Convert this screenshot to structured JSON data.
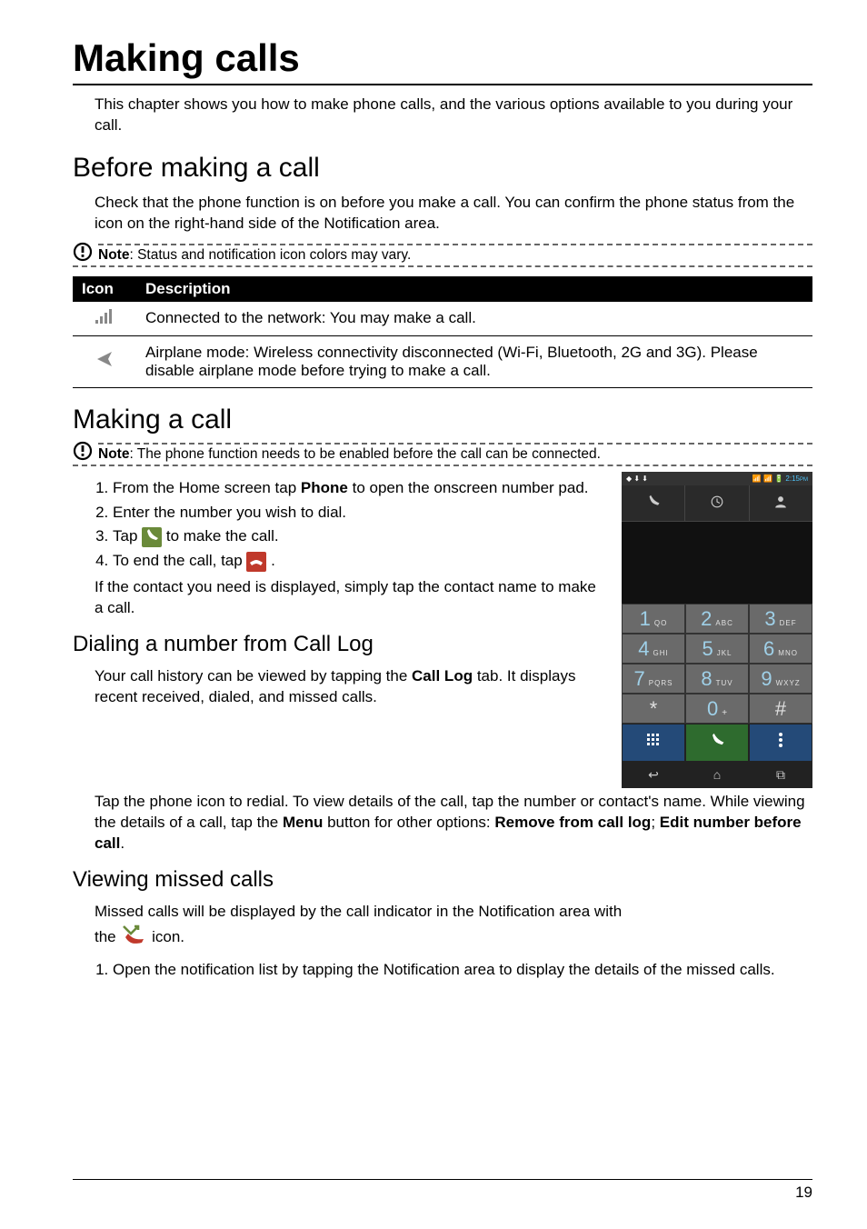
{
  "title": "Making calls",
  "intro": "This chapter shows you how to make phone calls, and the various options available to you during your call.",
  "section_before": {
    "heading": "Before making a call",
    "text": "Check that the phone function is on before you make a call. You can confirm the phone status from the icon on the right-hand side of the Notification area.",
    "note_label": "Note",
    "note_text": ": Status and notification icon colors may vary."
  },
  "table": {
    "headers": [
      "Icon",
      "Description"
    ],
    "rows": [
      {
        "icon": "signal-icon",
        "desc": "Connected to the network: You may make a call."
      },
      {
        "icon": "airplane-icon",
        "desc": "Airplane mode: Wireless connectivity disconnected (Wi-Fi, Bluetooth, 2G and 3G). Please disable airplane mode before trying to make a call."
      }
    ]
  },
  "section_making": {
    "heading": "Making a call",
    "note_label": "Note",
    "note_text": ": The phone function needs to be enabled before the call can be connected.",
    "step1_a": "From the Home screen tap ",
    "step1_b": "Phone",
    "step1_c": " to open the onscreen number pad.",
    "step2": "Enter the number you wish to dial.",
    "step3_a": "Tap ",
    "step3_b": " to make the call.",
    "step4_a": "To end the call, tap ",
    "step4_b": ".",
    "contact_text": "If the contact you need is displayed, simply tap the contact name to make a call."
  },
  "section_calllog": {
    "heading": "Dialing a number from Call Log",
    "p1_a": "Your call history can be viewed by tapping the ",
    "p1_b": "Call Log",
    "p1_c": " tab. It displays recent received, dialed, and missed calls.",
    "p2_a": "Tap the phone icon to redial. To view details of the call, tap the number or contact's name. While viewing the details of a call, tap the ",
    "p2_b": "Menu",
    "p2_c": " button for other options: ",
    "p2_d": "Remove from call log",
    "p2_e": "; ",
    "p2_f": "Edit number before call",
    "p2_g": "."
  },
  "section_missed": {
    "heading": "Viewing missed calls",
    "p1": "Missed calls will be displayed by the call indicator in the Notification area with",
    "p2_a": "the ",
    "p2_b": " icon.",
    "step1": "Open the notification list by tapping the Notification area to display the details of the missed calls."
  },
  "phone_mock": {
    "status_time": "2:15",
    "status_pm": "PM",
    "keys": [
      {
        "d": "1",
        "l": "QO"
      },
      {
        "d": "2",
        "l": "ABC"
      },
      {
        "d": "3",
        "l": "DEF"
      },
      {
        "d": "4",
        "l": "GHI"
      },
      {
        "d": "5",
        "l": "JKL"
      },
      {
        "d": "6",
        "l": "MNO"
      },
      {
        "d": "7",
        "l": "PQRS"
      },
      {
        "d": "8",
        "l": "TUV"
      },
      {
        "d": "9",
        "l": "WXYZ"
      },
      {
        "d": "*",
        "l": ""
      },
      {
        "d": "0",
        "l": "+"
      },
      {
        "d": "#",
        "l": ""
      }
    ]
  },
  "page_number": "19"
}
